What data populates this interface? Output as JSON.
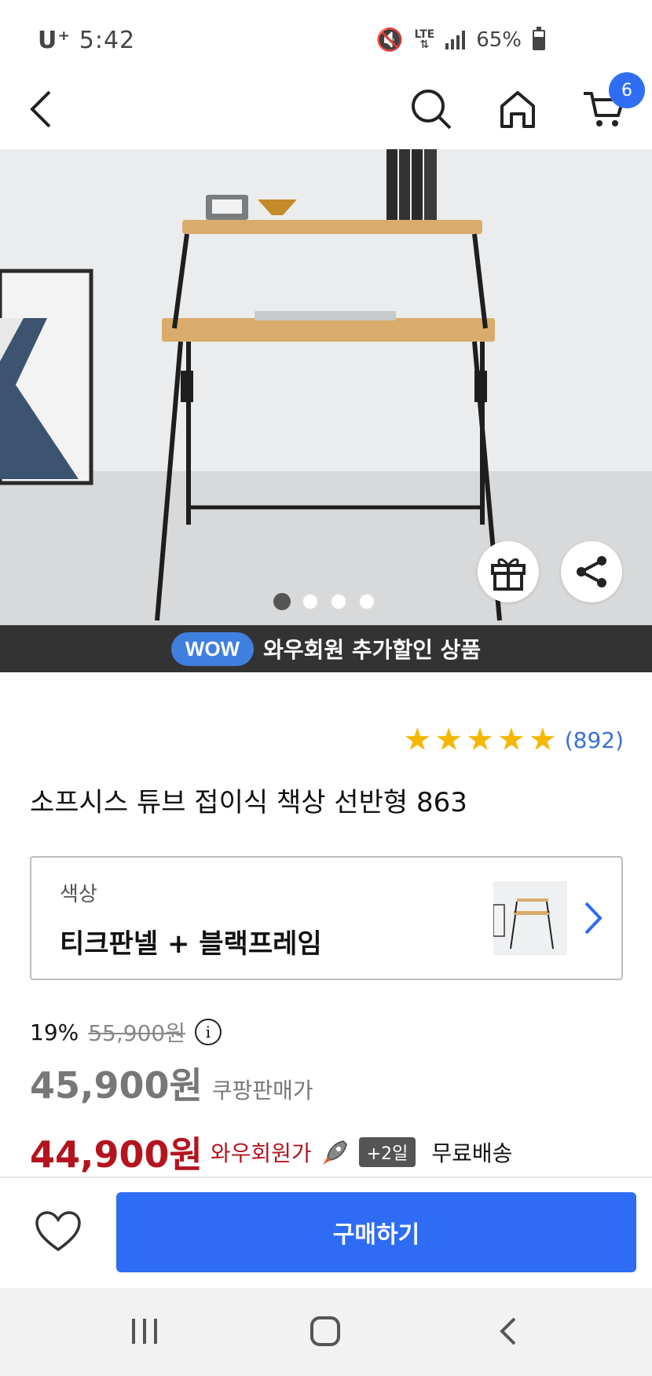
{
  "status_bar": {
    "carrier": "U⁺",
    "time": "5:42",
    "network": "LTE",
    "battery": "65%"
  },
  "header": {
    "cart_count": "6"
  },
  "hero": {
    "slide_count": 4,
    "active_slide": 1
  },
  "wow_banner": {
    "pill": "WOW",
    "text": "와우회원 추가할인 상품"
  },
  "rating": {
    "stars": 5,
    "review_count": "(892)"
  },
  "product": {
    "title": "소프시스 튜브 접이식 책상 선반형 863"
  },
  "option": {
    "label": "색상",
    "value": "티크판넬 + 블랙프레임"
  },
  "price": {
    "discount": "19%",
    "original": "55,900원",
    "sale": "45,900원",
    "sale_label": "쿠팡판매가",
    "wow": "44,900원",
    "wow_label": "와우회원가",
    "delivery_badge": "+2일",
    "shipping": "무료배송"
  },
  "bottom_bar": {
    "buy_label": "구매하기"
  },
  "colors": {
    "accent": "#2e6cf6",
    "wow_price": "#b4141e",
    "star": "#f5b700",
    "banner_bg": "#333333"
  }
}
